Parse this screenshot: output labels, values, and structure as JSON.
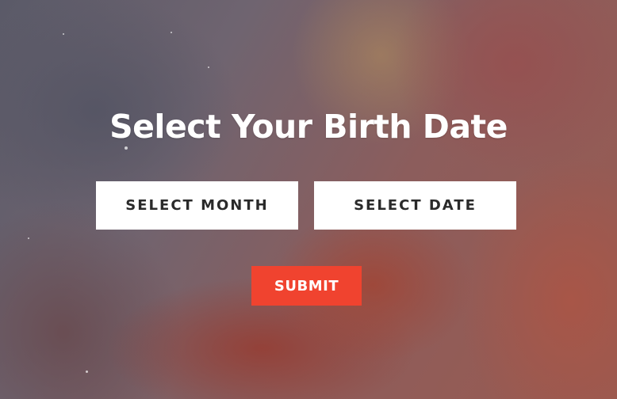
{
  "heading": "Select Your Birth Date",
  "month_select": {
    "label": "SELECT MONTH"
  },
  "date_select": {
    "label": "SELECT DATE"
  },
  "submit": {
    "label": "SUBMIT"
  },
  "colors": {
    "submit_bg": "#f0432f",
    "select_bg": "#ffffff",
    "select_text": "#2a2a2a",
    "heading_text": "#ffffff"
  }
}
